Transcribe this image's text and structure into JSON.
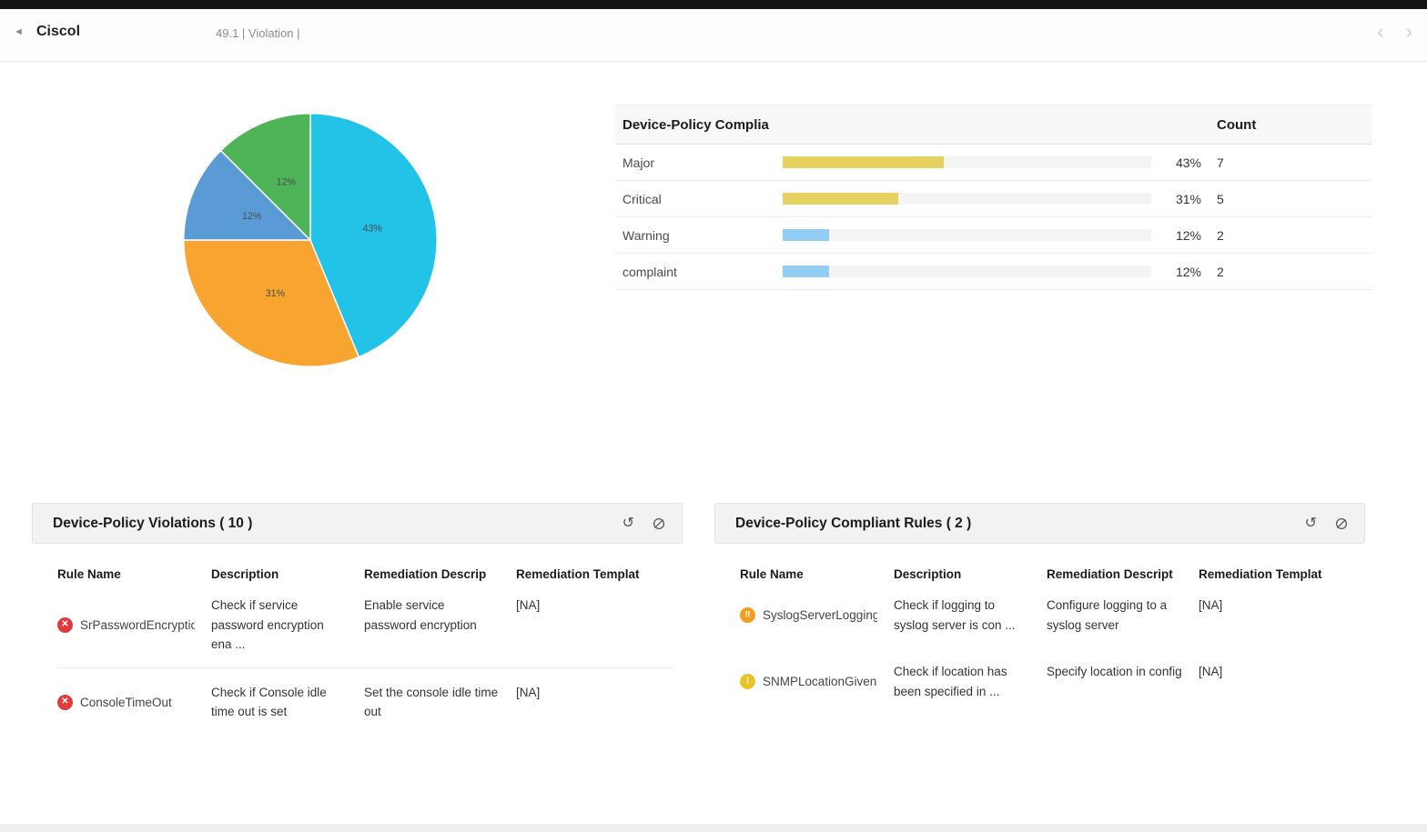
{
  "topbar": {
    "back_glyph": "◄",
    "title": "Ciscol",
    "breadcrumb": "49.1 | Violation |",
    "prev_glyph": "‹",
    "next_glyph": "›"
  },
  "chart_data": {
    "type": "pie",
    "title": "Device-Policy Complia",
    "categories": [
      "Major",
      "Critical",
      "Warning",
      "complaint"
    ],
    "values": [
      7,
      5,
      2,
      2
    ],
    "percent_labels": [
      "43%",
      "31%",
      "12%",
      "12%"
    ],
    "colors": [
      "#22c3e6",
      "#f7a431",
      "#5b9bd5",
      "#4fb357"
    ],
    "legend_position": "none"
  },
  "compliance_table": {
    "title": "Device-Policy Complia",
    "count_header": "Count",
    "rows": [
      {
        "label": "Major",
        "percent": "43%",
        "count": "7",
        "fraction": 0.4375,
        "bar_color": "#e6d060"
      },
      {
        "label": "Critical",
        "percent": "31%",
        "count": "5",
        "fraction": 0.3125,
        "bar_color": "#e6d060"
      },
      {
        "label": "Warning",
        "percent": "12%",
        "count": "2",
        "fraction": 0.125,
        "bar_color": "#92cdf4"
      },
      {
        "label": "complaint",
        "percent": "12%",
        "count": "2",
        "fraction": 0.125,
        "bar_color": "#92cdf4"
      }
    ]
  },
  "status_colors": {
    "critical": "#e23b3b",
    "major": "#f39c1f",
    "warning": "#e9c428"
  },
  "panel_icons": {
    "refresh_glyph": "↺"
  },
  "violations_panel": {
    "title": "Device-Policy Violations ( 10 )",
    "columns": [
      "Rule Name",
      "Description",
      "Remediation Descrip",
      "Remediation Templat"
    ],
    "rows": [
      {
        "glyph": "✕",
        "rule": "SrPasswordEncryptionI",
        "description": "Check if service password encryption ena ...",
        "remediation": "Enable service password encryption",
        "template": "[NA]"
      },
      {
        "glyph": "✕",
        "rule": "ConsoleTimeOut",
        "description": "Check if Console idle time out is set",
        "remediation": "Set the console idle time out",
        "template": "[NA]"
      }
    ]
  },
  "compliant_panel": {
    "title": "Device-Policy Compliant Rules ( 2 )",
    "columns": [
      "Rule Name",
      "Description",
      "Remediation Descript",
      "Remediation Templat"
    ],
    "rows": [
      {
        "glyph": "‼",
        "rule": "SyslogServerLoggingEna",
        "description": "Check if logging to syslog server is con ...",
        "remediation": "Configure logging to a syslog server",
        "template": "[NA]"
      },
      {
        "glyph": "!",
        "rule": "SNMPLocationGiven",
        "description": "Check if location has been specified in ...",
        "remediation": "Specify location in config",
        "template": "[NA]"
      }
    ]
  }
}
